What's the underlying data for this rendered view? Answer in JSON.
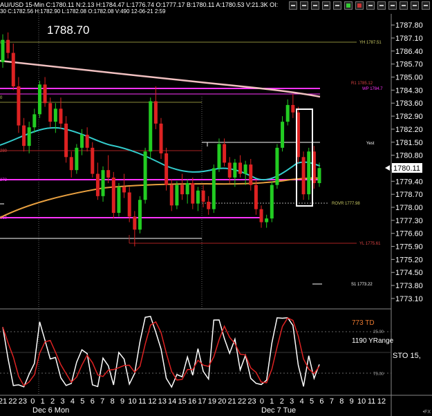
{
  "header": {
    "title": "AU/USD  15-Min  C:1780.11  N:2.13  H:1784.47  L:1776.74  O:1777.17  B:1780.11  A:1780.53  V:21.3K  OI:",
    "info": "30  C:1782.56  H:1782.90  L:1782.08  O:1782.08  V:490  12-06-21  2:59",
    "big_price": "1788.70",
    "toolbar_icons": [
      "grid-icon",
      "bars-icon",
      "line-icon",
      "plus-icon",
      "minus-icon",
      "green-box-icon",
      "red-box-icon",
      "sync-icon",
      "arrow-up-icon",
      "arrow-down-icon",
      "arrow-left-icon",
      "arrow-right-icon",
      "zoom-icon",
      "close-icon"
    ]
  },
  "price_axis": {
    "ticks": [
      "1787.80",
      "1787.10",
      "1786.40",
      "1785.70",
      "1785.00",
      "1784.30",
      "1783.60",
      "1782.90",
      "1782.20",
      "1781.50",
      "1780.80",
      "1780.11",
      "1779.40",
      "1778.70",
      "1778.00",
      "1777.30",
      "1776.60",
      "1775.90",
      "1775.20",
      "1774.50",
      "1773.80",
      "1773.10"
    ],
    "current": "1780.11"
  },
  "levels": {
    "yh": "YH 1787.51",
    "r1": "R1 1785.12",
    "wp": "WP 1784.7",
    "yest": "Yest",
    "rovr": "ROVR 1777.98",
    "yl": "YL 1775.61",
    "s1": "S1 1773.22",
    "left_a": "1",
    "left_b": "0",
    "left_c": "280",
    "left_d": "272",
    "left_e": "810"
  },
  "indicator": {
    "td": "773 TD",
    "yrange": "1190 YRange",
    "sto": "STO  15,",
    "level_25": "25.00",
    "level_75": "75.00"
  },
  "time_axis": {
    "hours": [
      "21",
      "22",
      "23",
      "0",
      "1",
      "2",
      "3",
      "4",
      "5",
      "6",
      "7",
      "8",
      "9",
      "10",
      "11",
      "12",
      "13",
      "14",
      "15",
      "16",
      "17",
      "19",
      "20",
      "21",
      "22",
      "23",
      "0",
      "1",
      "2",
      "3",
      "4",
      "5",
      "6",
      "7",
      "8",
      "9",
      "10",
      "11",
      "12"
    ],
    "day1": "Dec 6 Mon",
    "day2": "Dec 7 Tue"
  },
  "footer": {
    "fx": "•FX"
  },
  "colors": {
    "up": "#22cc22",
    "down": "#dd2222",
    "magenta": "#ff33ff",
    "cyan": "#33cccc",
    "orange": "#e8a040",
    "pink": "#f0c0c0",
    "white": "#ffffff",
    "olive": "#8b8b3a",
    "darkred": "#aa2222"
  },
  "chart_data": {
    "type": "candlestick",
    "timeframe": "15-Min",
    "ylim": [
      1772.8,
      1788.4
    ],
    "candles": [
      [
        1785.8,
        1787.3,
        1785.5,
        1787.0
      ],
      [
        1787.0,
        1787.4,
        1786.0,
        1786.3
      ],
      [
        1786.3,
        1786.8,
        1784.3,
        1784.5
      ],
      [
        1784.5,
        1785.0,
        1782.0,
        1782.4
      ],
      [
        1782.4,
        1782.8,
        1781.0,
        1781.3
      ],
      [
        1781.3,
        1782.6,
        1780.9,
        1782.3
      ],
      [
        1782.3,
        1783.3,
        1782.0,
        1783.0
      ],
      [
        1783.0,
        1784.8,
        1782.8,
        1784.6
      ],
      [
        1784.6,
        1785.0,
        1783.4,
        1783.6
      ],
      [
        1783.6,
        1783.9,
        1782.3,
        1782.6
      ],
      [
        1782.6,
        1783.6,
        1782.0,
        1783.3
      ],
      [
        1783.3,
        1783.9,
        1782.2,
        1782.5
      ],
      [
        1782.5,
        1782.9,
        1780.4,
        1780.7
      ],
      [
        1780.7,
        1781.0,
        1779.6,
        1780.0
      ],
      [
        1780.0,
        1781.4,
        1779.8,
        1781.2
      ],
      [
        1781.2,
        1782.2,
        1780.8,
        1781.9
      ],
      [
        1781.9,
        1782.3,
        1781.0,
        1781.2
      ],
      [
        1781.2,
        1781.5,
        1779.6,
        1779.8
      ],
      [
        1779.8,
        1780.4,
        1778.4,
        1778.6
      ],
      [
        1778.6,
        1780.2,
        1778.3,
        1780.0
      ],
      [
        1780.0,
        1780.8,
        1779.3,
        1779.6
      ],
      [
        1779.6,
        1779.9,
        1777.4,
        1777.7
      ],
      [
        1777.7,
        1779.3,
        1777.5,
        1779.1
      ],
      [
        1779.1,
        1779.8,
        1778.5,
        1778.8
      ],
      [
        1778.8,
        1779.1,
        1777.2,
        1777.5
      ],
      [
        1777.5,
        1777.8,
        1775.9,
        1776.8
      ],
      [
        1776.8,
        1778.6,
        1776.6,
        1778.4
      ],
      [
        1778.4,
        1781.2,
        1778.2,
        1781.0
      ],
      [
        1781.0,
        1783.9,
        1780.6,
        1783.7
      ],
      [
        1783.7,
        1784.5,
        1782.2,
        1782.5
      ],
      [
        1782.5,
        1782.8,
        1780.6,
        1780.9
      ],
      [
        1780.9,
        1781.2,
        1778.9,
        1779.2
      ],
      [
        1779.2,
        1779.5,
        1777.8,
        1778.1
      ],
      [
        1778.1,
        1779.4,
        1777.9,
        1779.2
      ],
      [
        1779.2,
        1779.8,
        1778.4,
        1778.7
      ],
      [
        1778.7,
        1779.5,
        1778.2,
        1779.3
      ],
      [
        1779.3,
        1779.6,
        1777.9,
        1778.2
      ],
      [
        1778.2,
        1779.1,
        1777.8,
        1778.9
      ],
      [
        1778.9,
        1779.2,
        1778.0,
        1778.3
      ],
      [
        1778.3,
        1778.6,
        1777.6,
        1777.9
      ],
      [
        1777.9,
        1780.3,
        1777.7,
        1780.1
      ],
      [
        1780.1,
        1781.7,
        1779.9,
        1781.4
      ],
      [
        1781.4,
        1781.7,
        1780.2,
        1780.4
      ],
      [
        1780.4,
        1780.7,
        1779.3,
        1779.6
      ],
      [
        1779.6,
        1780.6,
        1779.1,
        1780.4
      ],
      [
        1780.4,
        1780.8,
        1779.6,
        1779.8
      ],
      [
        1779.8,
        1780.5,
        1779.2,
        1780.3
      ],
      [
        1780.3,
        1780.6,
        1778.9,
        1779.2
      ],
      [
        1779.2,
        1779.5,
        1777.6,
        1777.9
      ],
      [
        1777.9,
        1778.1,
        1776.9,
        1777.2
      ],
      [
        1777.2,
        1777.6,
        1776.9,
        1777.4
      ],
      [
        1777.4,
        1779.4,
        1777.2,
        1779.2
      ],
      [
        1779.2,
        1781.4,
        1779.0,
        1781.2
      ],
      [
        1781.2,
        1782.9,
        1781.0,
        1782.6
      ],
      [
        1782.6,
        1783.8,
        1782.4,
        1783.5
      ],
      [
        1783.5,
        1784.1,
        1782.8,
        1783.1
      ],
      [
        1783.1,
        1783.4,
        1780.4,
        1780.7
      ],
      [
        1780.7,
        1781.0,
        1778.4,
        1778.7
      ],
      [
        1778.7,
        1781.2,
        1778.4,
        1781.0
      ],
      [
        1781.0,
        1781.3,
        1779.0,
        1779.3
      ],
      [
        1779.3,
        1780.4,
        1779.1,
        1780.11
      ]
    ]
  }
}
